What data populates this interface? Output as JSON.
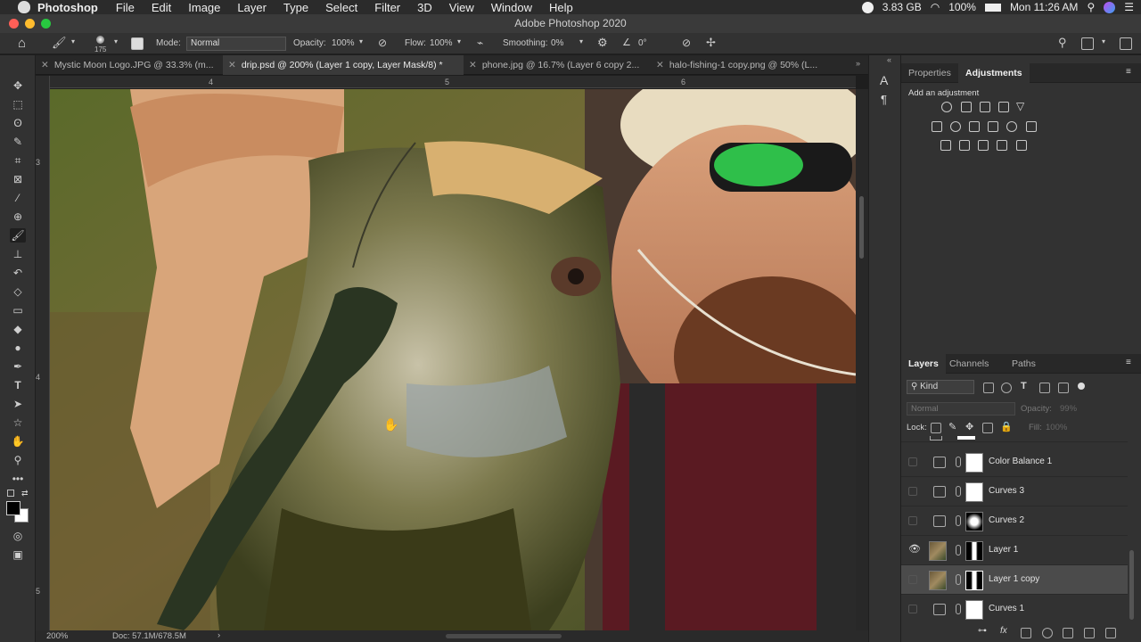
{
  "menubar": {
    "app": "Photoshop",
    "items": [
      "File",
      "Edit",
      "Image",
      "Layer",
      "Type",
      "Select",
      "Filter",
      "3D",
      "View",
      "Window",
      "Help"
    ],
    "memory": "3.83 GB",
    "battery": "100%",
    "clock": "Mon 11:26 AM"
  },
  "titlebar": {
    "title": "Adobe Photoshop 2020"
  },
  "options": {
    "brush_size": "175",
    "mode_label": "Mode:",
    "mode_value": "Normal",
    "opacity_label": "Opacity:",
    "opacity_value": "100%",
    "flow_label": "Flow:",
    "flow_value": "100%",
    "smoothing_label": "Smoothing:",
    "smoothing_value": "0%",
    "angle_value": "0°"
  },
  "tabs": [
    {
      "label": "Mystic Moon Logo.JPG @ 33.3% (m..."
    },
    {
      "label": "drip.psd @ 200% (Layer 1 copy, Layer Mask/8) *"
    },
    {
      "label": "phone.jpg @ 16.7% (Layer 6 copy 2..."
    },
    {
      "label": "halo-fishing-1 copy.png @ 50% (L..."
    }
  ],
  "rulers": {
    "h": [
      "4",
      "5",
      "6"
    ],
    "v": [
      "3",
      "4",
      "5"
    ]
  },
  "status": {
    "zoom": "200%",
    "doc": "Doc: 57.1M/678.5M"
  },
  "panels": {
    "top_tabs": [
      "Properties",
      "Adjustments"
    ],
    "adjust_hint": "Add an adjustment",
    "bottom_tabs": [
      "Layers",
      "Channels",
      "Paths"
    ],
    "filter_kind": "Kind",
    "blend_mode": "Normal",
    "opacity_label": "Opacity:",
    "opacity_value": "99%",
    "lock_label": "Lock:",
    "fill_label": "Fill:",
    "fill_value": "100%"
  },
  "layers": [
    {
      "name": "Color Balance 1",
      "type": "adjustment",
      "visible": false
    },
    {
      "name": "Curves 3",
      "type": "adjustment",
      "visible": false
    },
    {
      "name": "Curves 2",
      "type": "adjustment",
      "visible": false
    },
    {
      "name": "Layer 1",
      "type": "pixel",
      "visible": true
    },
    {
      "name": "Layer 1 copy",
      "type": "pixel",
      "visible": false,
      "selected": true
    },
    {
      "name": "Curves 1",
      "type": "adjustment",
      "visible": false
    }
  ]
}
